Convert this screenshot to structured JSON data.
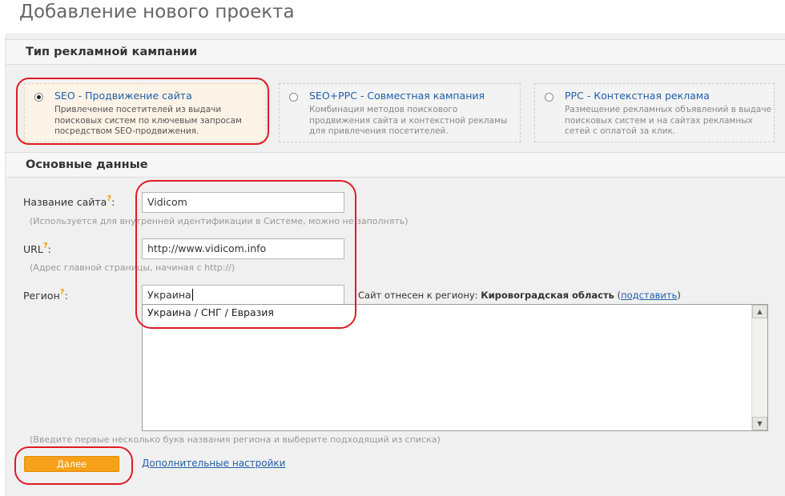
{
  "page_title": "Добавление нового проекта",
  "campaign_section": {
    "title": "Тип рекламной кампании",
    "options": [
      {
        "title": "SEO - Продвижение сайта",
        "desc": "Привлечение посетителей из выдачи поисковых систем по ключевым запросам посредством SEO-продвижения.",
        "selected": true
      },
      {
        "title": "SEO+PPC - Совместная кампания",
        "desc": "Комбинация методов поискового продвижения сайта и контекстной рекламы для привлечения посетителей.",
        "selected": false
      },
      {
        "title": "PPC - Контекстная реклама",
        "desc": "Размещение рекламных объявлений в выдаче поисковых систем и на сайтах рекламных сетей с оплатой за клик.",
        "selected": false
      }
    ]
  },
  "main_section": {
    "title": "Основные данные",
    "help_mark": "?",
    "site_name": {
      "label": "Название сайта",
      "label_suffix": ":",
      "value": "Vidicom",
      "hint": "(Используется для внутренней идентификации в Системе, можно не заполнять)"
    },
    "url": {
      "label": "URL",
      "label_suffix": ":",
      "value": "http://www.vidicom.info",
      "hint": "(Адрес главной страницы, начиная с http://)"
    },
    "region": {
      "label": "Регион",
      "label_suffix": ":",
      "value": "Украина",
      "info_prefix": "Сайт отнесен к региону:",
      "info_region": "Кировоградская область",
      "info_link": "подставить",
      "suggestions": [
        "Украина / СНГ / Евразия"
      ],
      "hint": "(Введите первые несколько букв названия региона и выберите подходящий из списка)"
    }
  },
  "actions": {
    "next_label": "Далее",
    "advanced_label": "Дополнительные настройки"
  },
  "colors": {
    "accent": "#f7a11a",
    "link": "#1f5fa8",
    "annotation": "#e01b24"
  }
}
